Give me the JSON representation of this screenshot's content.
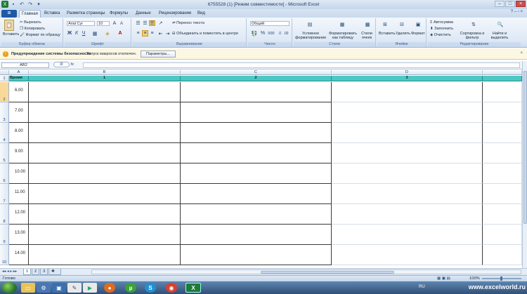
{
  "window": {
    "title": "6755528 (1) [Режим совместимости] - Microsoft Excel"
  },
  "tabs": [
    {
      "label": "Главная",
      "active": true
    },
    {
      "label": "Вставка"
    },
    {
      "label": "Разметка страницы"
    },
    {
      "label": "Формулы"
    },
    {
      "label": "Данные"
    },
    {
      "label": "Рецензирование"
    },
    {
      "label": "Вид"
    }
  ],
  "ribbon": {
    "clipboard": {
      "paste": "Вставить",
      "cut": "Вырезать",
      "copy": "Копировать",
      "format_painter": "Формат по образцу",
      "label": "Буфер обмена"
    },
    "font": {
      "name": "Arial Cyr",
      "size": "10",
      "label": "Шрифт",
      "bold": "Ж",
      "italic": "К",
      "underline": "Ч"
    },
    "alignment": {
      "wrap": "Перенос текста",
      "merge": "Объединить и поместить в центре",
      "label": "Выравнивание"
    },
    "number": {
      "format": "Общий",
      "label": "Число",
      "percent": "%",
      "thousands": "000"
    },
    "styles": {
      "conditional": "Условное форматирование",
      "as_table": "Форматировать как таблицу",
      "cell_styles": "Стили ячеек",
      "label": "Стили"
    },
    "cells": {
      "insert": "Вставить",
      "delete": "Удалить",
      "format": "Формат",
      "label": "Ячейки"
    },
    "editing": {
      "autosum": "Автосумма",
      "fill": "Заполнить",
      "clear": "Очистить",
      "sort": "Сортировка и фильтр",
      "find": "Найти и выделить",
      "label": "Редактирование"
    }
  },
  "security": {
    "title": "Предупреждение системы безопасности",
    "message": "Запуск макросов отключен.",
    "button": "Параметры..."
  },
  "formula_bar": {
    "name_box": "AB2",
    "fx": "fx",
    "value": ""
  },
  "grid": {
    "columns": [
      "A",
      "B",
      "C",
      "D"
    ],
    "header_row": {
      "row": "1",
      "a": "Время",
      "b": "1",
      "c": "2",
      "d": "3"
    },
    "rows": [
      {
        "row": "2",
        "time": "6.00"
      },
      {
        "row": "3",
        "time": "7.00"
      },
      {
        "row": "4",
        "time": "8.00"
      },
      {
        "row": "5",
        "time": "9.00"
      },
      {
        "row": "6",
        "time": "10.00"
      },
      {
        "row": "7",
        "time": "11.00"
      },
      {
        "row": "8",
        "time": "12.00"
      },
      {
        "row": "9",
        "time": "13.00"
      },
      {
        "row": "10",
        "time": "14.00"
      }
    ]
  },
  "sheets": [
    "1",
    "2",
    "3"
  ],
  "status": {
    "ready": "Готово",
    "zoom": "100%"
  },
  "taskbar": {
    "lang": "RU",
    "watermark": "www.excelworld.ru"
  }
}
